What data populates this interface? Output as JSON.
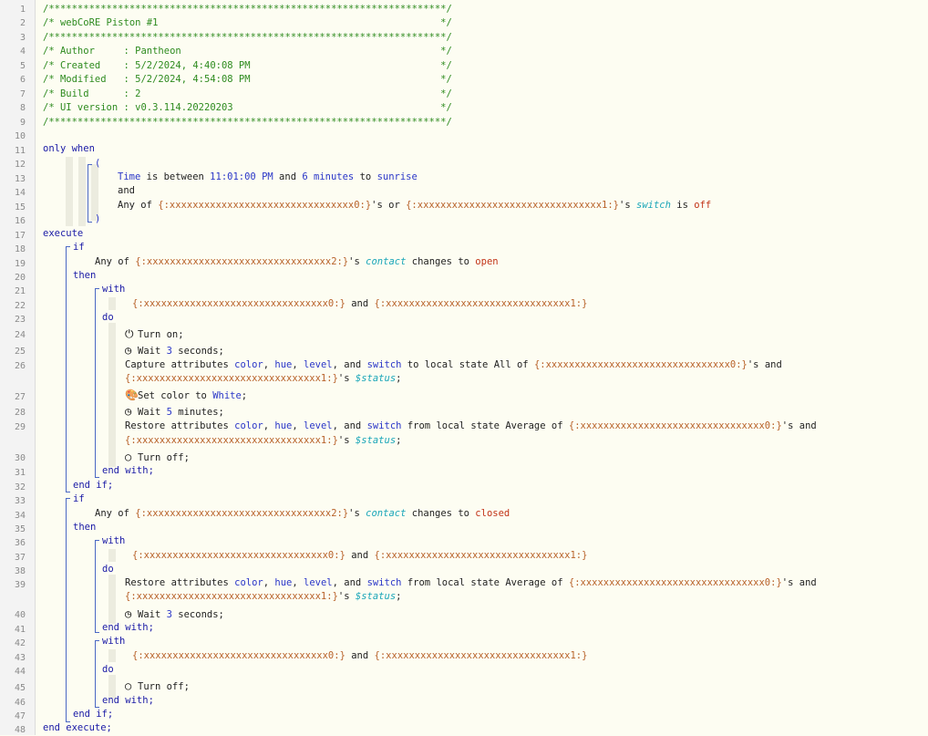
{
  "header": [
    "/*********************************************************************/",
    "/* webCoRE Piston #1                                                 */",
    "/*********************************************************************/",
    "/* Author     : Pantheon                                             */",
    "/* Created    : 5/2/2024, 4:40:08 PM                                 */",
    "/* Modified   : 5/2/2024, 4:54:08 PM                                 */",
    "/* Build      : 2                                                    */",
    "/* UI version : v0.3.114.20220203                                    */",
    "/*********************************************************************/"
  ],
  "line_numbers": [
    "1",
    "2",
    "3",
    "4",
    "5",
    "6",
    "7",
    "8",
    "9",
    "10",
    "11",
    "12",
    "13",
    "14",
    "15",
    "16",
    "17",
    "18",
    "19",
    "20",
    "21",
    "22",
    "23",
    "24",
    "25",
    "26",
    "27",
    "28",
    "29",
    "30",
    "31",
    "32",
    "33",
    "34",
    "35",
    "36",
    "37",
    "38",
    "39",
    "40",
    "41",
    "42",
    "43",
    "44",
    "45",
    "46",
    "47",
    "48"
  ],
  "devices": {
    "d0": "{:xxxxxxxxxxxxxxxxxxxxxxxxxxxxxxxx0:}",
    "d1": "{:xxxxxxxxxxxxxxxxxxxxxxxxxxxxxxxx1:}",
    "d2": "{:xxxxxxxxxxxxxxxxxxxxxxxxxxxxxxxx2:}"
  },
  "kw": {
    "only_when": "only when",
    "execute": "execute",
    "if": "if",
    "then": "then",
    "with": "with",
    "do": "do",
    "end_with": "end with;",
    "end_if": "end if;",
    "end_execute": "end execute;",
    "and": "and",
    "open_paren": "(",
    "close_paren": ")"
  },
  "cond": {
    "time": "Time",
    "is_between": "is between",
    "t1": "11:01:00 PM",
    "and": "and",
    "n6": "6",
    "minutes_to": "minutes",
    "to": "to",
    "sunrise": "sunrise",
    "any_of": "Any of",
    "s_or": "'s or",
    "s_": "'s",
    "switch": "switch",
    "is": "is",
    "off": "off",
    "contact": "contact",
    "changes_to": "changes to",
    "open": "open",
    "closed": "closed"
  },
  "stmt": {
    "turn_on": "Turn on;",
    "wait": "Wait",
    "seconds": "seconds;",
    "minutes": "minutes;",
    "n3": "3",
    "n5": "5",
    "capture": "Capture attributes",
    "restore": "Restore attributes",
    "color": "color",
    "hue": "hue",
    "level": "level",
    "and_kw": "and",
    "switch": "switch",
    "to_local_state": "to local state",
    "from_local_state": "from local state",
    "all_of": "All of",
    "average_of": "Average of",
    "s_and": "'s and",
    "s_": "'s",
    "status": "$status",
    "semi": ";",
    "set_color_to": "Set color to",
    "white": "White",
    "turn_off": "Turn off;",
    "comma": ","
  }
}
